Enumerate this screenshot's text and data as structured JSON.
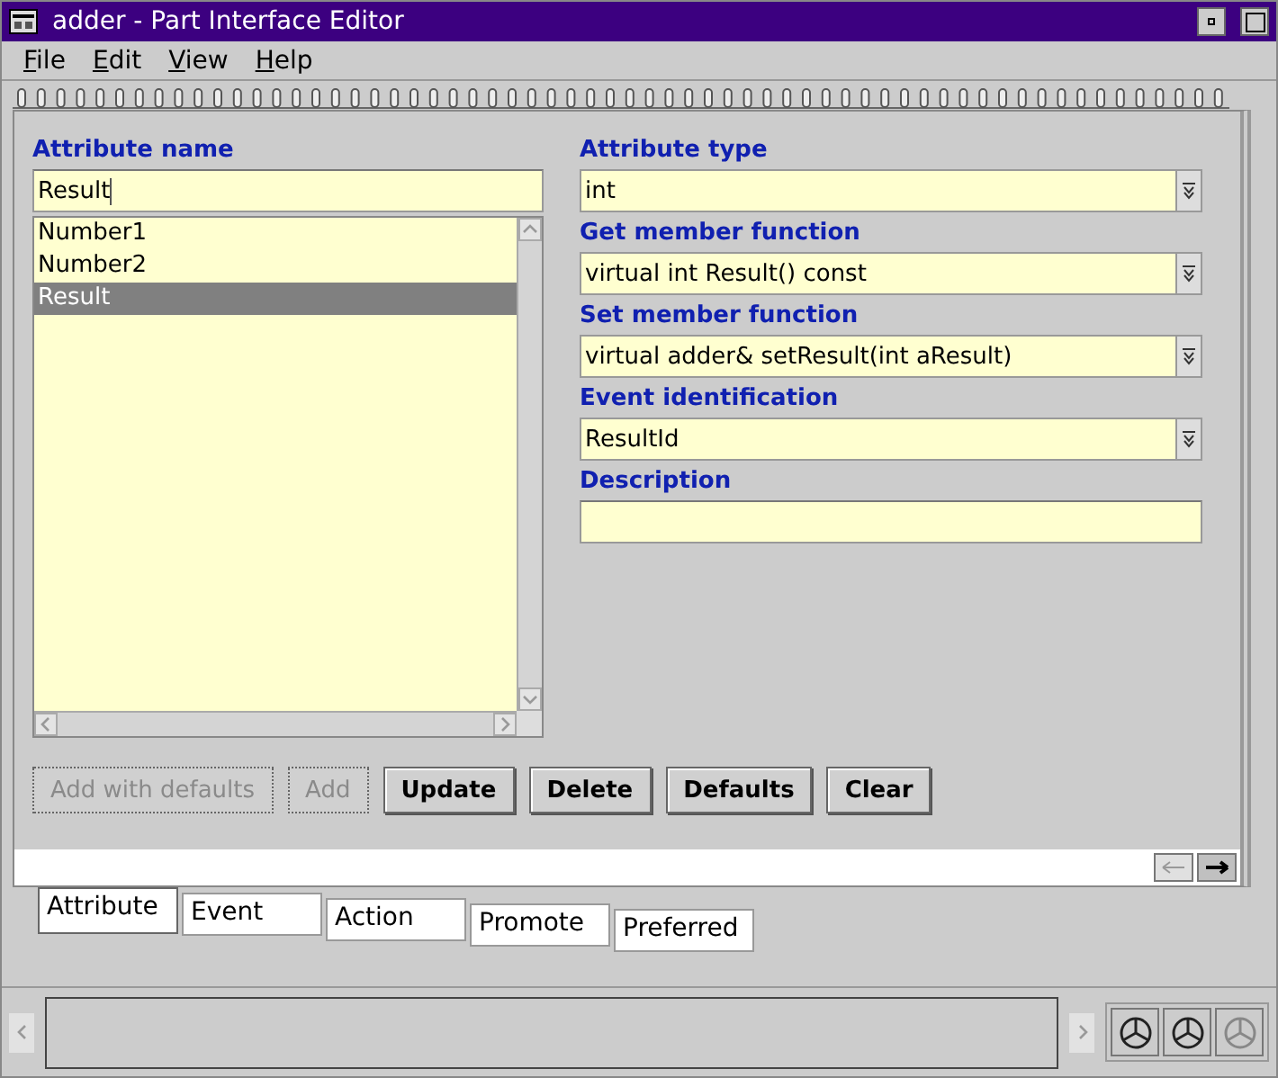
{
  "window": {
    "title": "adder - Part Interface Editor"
  },
  "menu": [
    "File",
    "Edit",
    "View",
    "Help"
  ],
  "attribute_name": {
    "label": "Attribute name",
    "value": "Result"
  },
  "attributes": [
    {
      "name": "Number1",
      "selected": false
    },
    {
      "name": "Number2",
      "selected": false
    },
    {
      "name": "Result",
      "selected": true
    }
  ],
  "fields": [
    {
      "label": "Attribute type",
      "value": "int",
      "kind": "dropdown"
    },
    {
      "label": "Get member function",
      "value": "virtual int Result() const",
      "kind": "dropdown"
    },
    {
      "label": "Set member function",
      "value": "virtual adder& setResult(int aResult)",
      "kind": "dropdown"
    },
    {
      "label": "Event identification",
      "value": "ResultId",
      "kind": "dropdown"
    },
    {
      "label": "Description",
      "kind": "text"
    }
  ],
  "buttons": [
    {
      "label": "Add with defaults",
      "disabled": true
    },
    {
      "label": "Add",
      "disabled": true
    },
    {
      "label": "Update",
      "disabled": false
    },
    {
      "label": "Delete",
      "disabled": false
    },
    {
      "label": "Defaults",
      "disabled": false
    },
    {
      "label": "Clear",
      "disabled": false
    }
  ],
  "tabs": [
    {
      "label": "Attribute",
      "selected": true
    },
    {
      "label": "Event",
      "selected": false
    },
    {
      "label": "Action",
      "selected": false
    },
    {
      "label": "Promote",
      "selected": false
    },
    {
      "label": "Preferred",
      "selected": false
    }
  ]
}
